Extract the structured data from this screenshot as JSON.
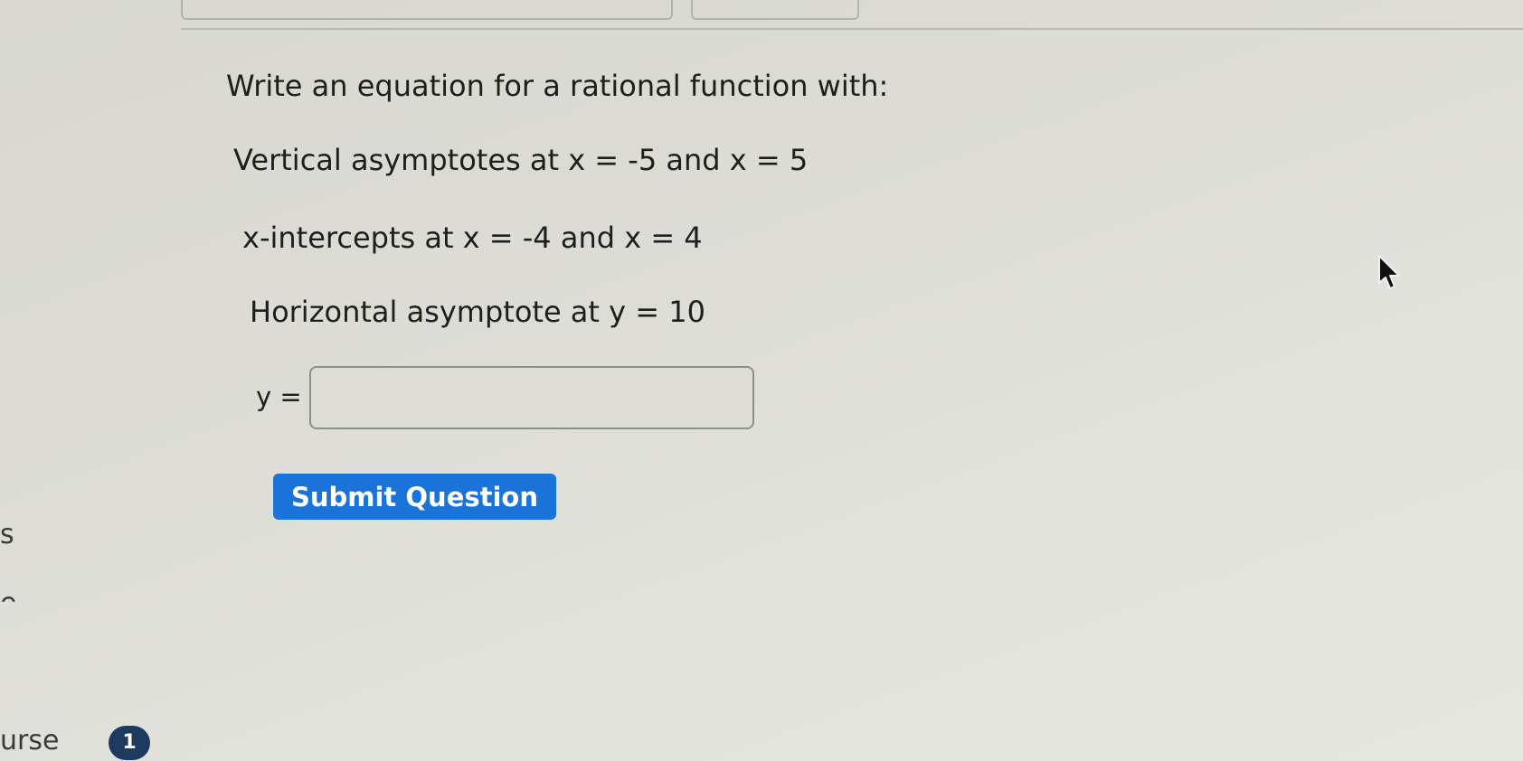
{
  "question": {
    "heading": "Write an equation for a rational function with:",
    "conditions": [
      "Vertical asymptotes at x = -5 and x = 5",
      "x-intercepts at x = -4 and x = 4",
      "Horizontal asymptote at y = 10"
    ]
  },
  "answer": {
    "label": "y =",
    "value": "",
    "placeholder": ""
  },
  "submit_label": "Submit Question",
  "sidebar": {
    "fragment_s": "s",
    "fragment_e": "e",
    "fragment_course": "urse",
    "badge_count": "1"
  },
  "colors": {
    "submit_button": "#1a73d9",
    "badge": "#1d3b5f"
  },
  "icons": {
    "cursor": "mouse-pointer-icon"
  }
}
